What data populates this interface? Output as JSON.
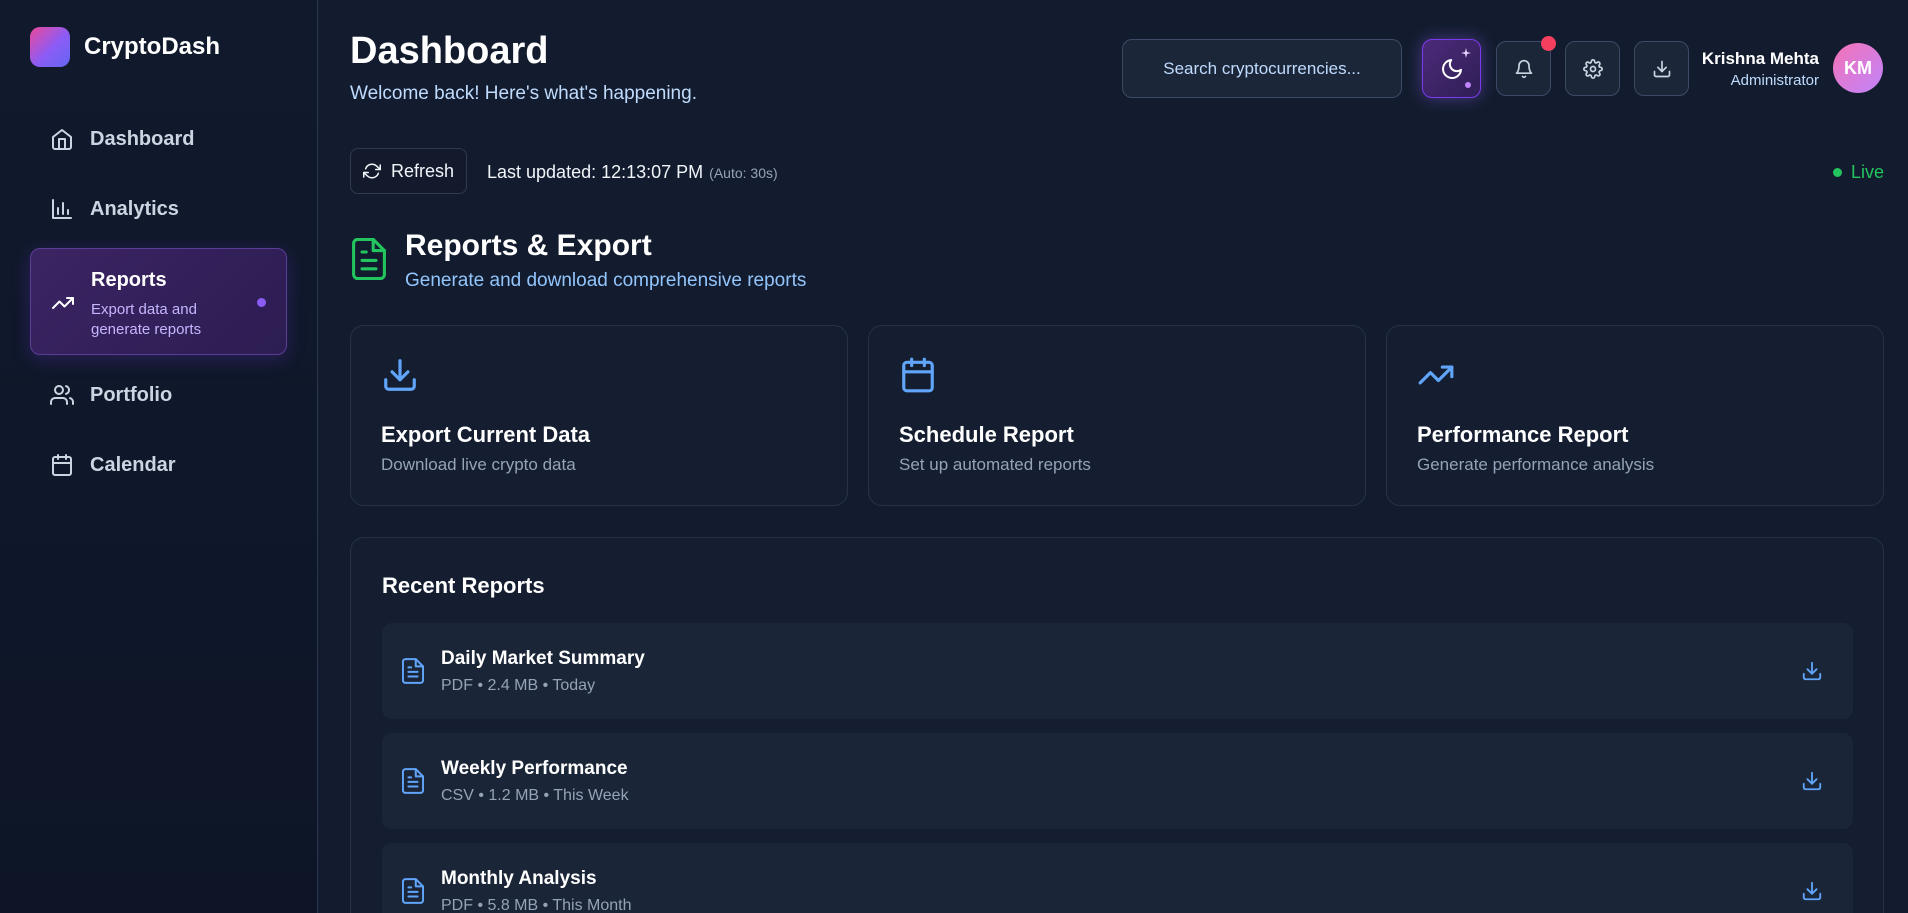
{
  "brand": {
    "name": "CryptoDash"
  },
  "sidebar": {
    "items": [
      {
        "label": "Dashboard",
        "icon": "home-icon"
      },
      {
        "label": "Analytics",
        "icon": "bar-chart-icon"
      },
      {
        "label": "Reports",
        "sub": "Export data and generate reports",
        "icon": "trending-up-icon",
        "active": true
      },
      {
        "label": "Portfolio",
        "icon": "users-icon"
      },
      {
        "label": "Calendar",
        "icon": "calendar-icon"
      }
    ]
  },
  "header": {
    "title": "Dashboard",
    "subtitle": "Welcome back! Here's what's happening.",
    "search_placeholder": "Search cryptocurrencies...",
    "user": {
      "name": "Krishna Mehta",
      "role": "Administrator",
      "initials": "KM"
    }
  },
  "status": {
    "refresh_label": "Refresh",
    "last_updated": "Last updated: 12:13:07 PM",
    "auto": "(Auto: 30s)",
    "live": "Live"
  },
  "section": {
    "title": "Reports & Export",
    "subtitle": "Generate and download comprehensive reports"
  },
  "cards": [
    {
      "title": "Export Current Data",
      "desc": "Download live crypto data",
      "icon": "download-icon"
    },
    {
      "title": "Schedule Report",
      "desc": "Set up automated reports",
      "icon": "calendar-icon"
    },
    {
      "title": "Performance Report",
      "desc": "Generate performance analysis",
      "icon": "trending-up-icon"
    }
  ],
  "recent": {
    "title": "Recent Reports",
    "items": [
      {
        "name": "Daily Market Summary",
        "meta": "PDF • 2.4 MB • Today"
      },
      {
        "name": "Weekly Performance",
        "meta": "CSV • 1.2 MB • This Week"
      },
      {
        "name": "Monthly Analysis",
        "meta": "PDF • 5.8 MB • This Month"
      }
    ]
  },
  "colors": {
    "background": "#131c2e",
    "accent_purple": "#8b5cf6",
    "accent_blue": "#60a5fa",
    "live_green": "#22c55e",
    "notification_red": "#f43f5e"
  }
}
